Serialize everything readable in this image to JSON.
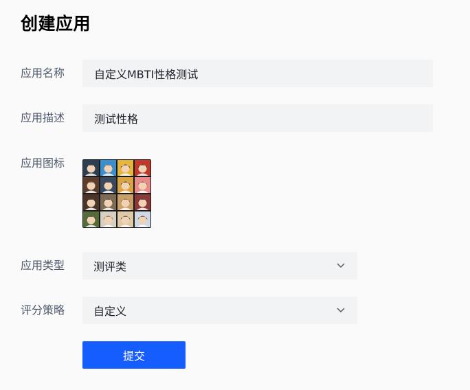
{
  "page": {
    "title": "创建应用"
  },
  "form": {
    "app_name": {
      "label": "应用名称",
      "value": "自定义MBTI性格测试"
    },
    "app_desc": {
      "label": "应用描述",
      "value": "测试性格"
    },
    "app_icon": {
      "label": "应用图标",
      "icon": "mbti-avatar-grid-image",
      "tile_colors": [
        "#2c3e50",
        "#3a8fd1",
        "#e7b43c",
        "#c0392b",
        "#5a3e2b",
        "#3b4a5e",
        "#d9a441",
        "#e88a8a",
        "#4a3528",
        "#7d6b55",
        "#c9a06a",
        "#8b3a3a",
        "#556b3a",
        "#d8cfc4",
        "#e0c9a6",
        "#cfd8e3"
      ]
    },
    "app_type": {
      "label": "应用类型",
      "value": "测评类"
    },
    "scoring_strategy": {
      "label": "评分策略",
      "value": "自定义"
    },
    "submit_label": "提交"
  },
  "colors": {
    "primary": "#165dff",
    "input_bg": "#f2f3f5",
    "label_text": "#4e5969",
    "page_bg": "#fafafb"
  }
}
